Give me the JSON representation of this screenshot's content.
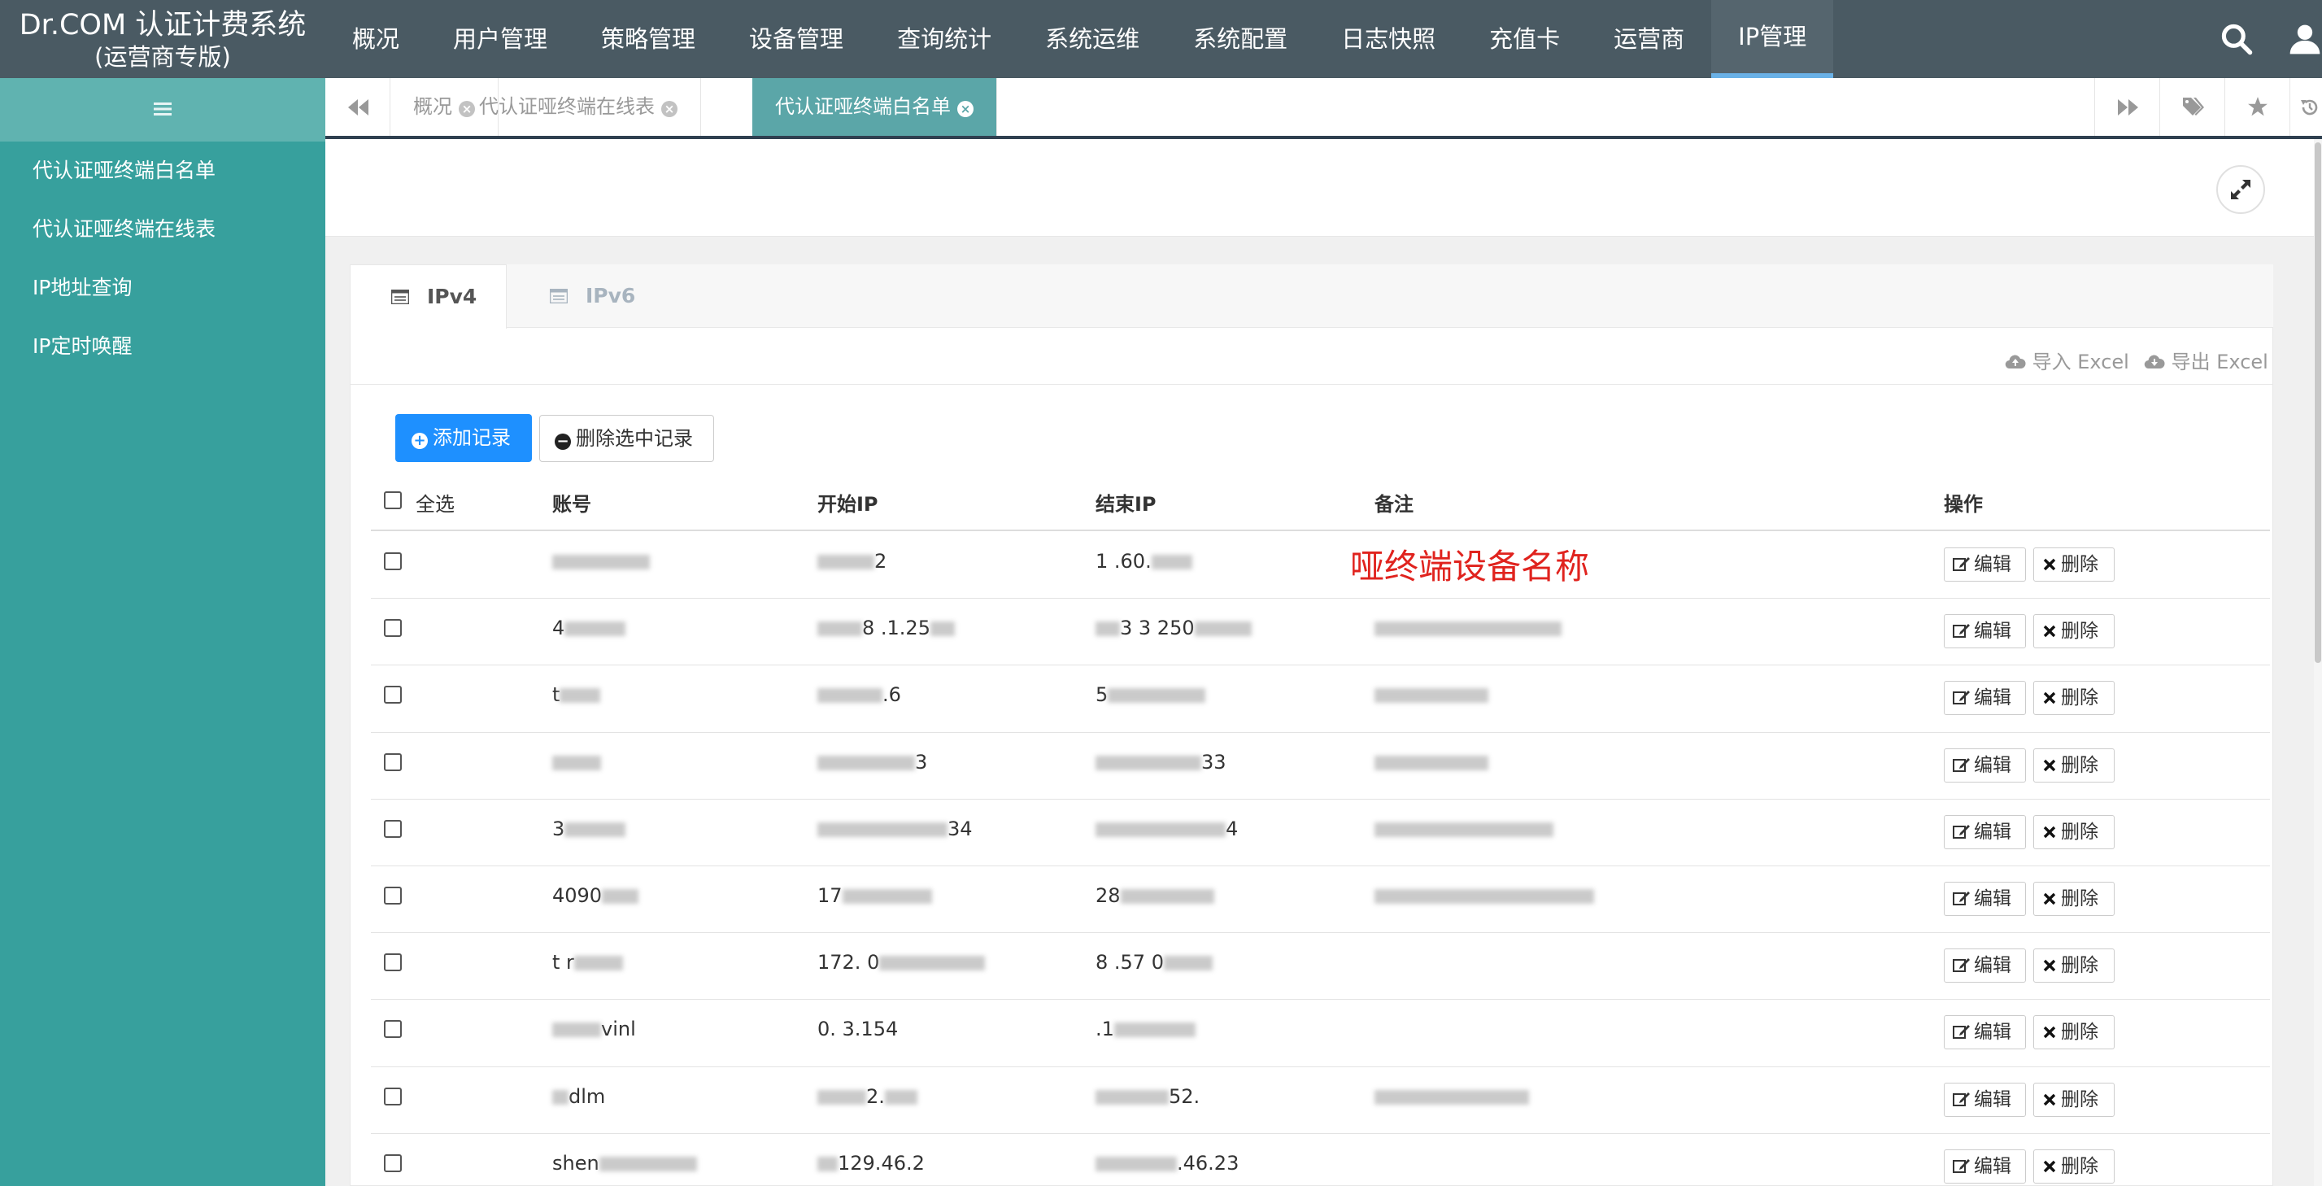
{
  "brand": {
    "line1": "Dr.COM 认证计费系统",
    "line2": "(运营商专版)"
  },
  "nav": [
    {
      "label": "概况"
    },
    {
      "label": "用户管理"
    },
    {
      "label": "策略管理"
    },
    {
      "label": "设备管理"
    },
    {
      "label": "查询统计"
    },
    {
      "label": "系统运维"
    },
    {
      "label": "系统配置"
    },
    {
      "label": "日志快照"
    },
    {
      "label": "充值卡"
    },
    {
      "label": "运营商"
    },
    {
      "label": "IP管理"
    }
  ],
  "nav_active": "IP管理",
  "sidebar": {
    "items": [
      {
        "label": "代认证哑终端白名单"
      },
      {
        "label": "代认证哑终端在线表"
      },
      {
        "label": "IP地址查询"
      },
      {
        "label": "IP定时唤醒"
      }
    ]
  },
  "page_tabs": [
    {
      "label": "概况",
      "active": false
    },
    {
      "label": "代认证哑终端在线表",
      "active": false
    },
    {
      "label": "代认证哑终端白名单",
      "active": true
    }
  ],
  "ip_tabs": [
    {
      "label": "IPv4",
      "active": true
    },
    {
      "label": "IPv6",
      "active": false
    }
  ],
  "excel": {
    "import_label": "导入 Excel",
    "export_label": "导出 Excel"
  },
  "toolbar": {
    "add_label": "添加记录",
    "delete_selected_label": "删除选中记录"
  },
  "table": {
    "select_all_label": "全选",
    "columns": [
      "账号",
      "开始IP",
      "结束IP",
      "备注",
      "操作"
    ],
    "edit_label": "编辑",
    "delete_label": "删除",
    "rows": [
      {
        "account": "",
        "start_ip": "2",
        "end_ip": "1 .60.",
        "remark": ""
      },
      {
        "account": "4",
        "start_ip": "8 .1.25",
        "end_ip": "3 3 250",
        "remark": ""
      },
      {
        "account": "t",
        "start_ip": ".6",
        "end_ip": "5",
        "remark": ""
      },
      {
        "account": "",
        "start_ip": "3",
        "end_ip": "33",
        "remark": ""
      },
      {
        "account": "3",
        "start_ip": "34",
        "end_ip": "4",
        "remark": ""
      },
      {
        "account": "4090",
        "start_ip": "17",
        "end_ip": "28",
        "remark": ""
      },
      {
        "account": "t r",
        "start_ip": "172. 0",
        "end_ip": "8 .57 0",
        "remark": ""
      },
      {
        "account": "vinl",
        "start_ip": "0. 3.154",
        "end_ip": ".1",
        "remark": ""
      },
      {
        "account": "dlm",
        "start_ip": "2.",
        "end_ip": "52.",
        "remark": ""
      },
      {
        "account": "shen",
        "start_ip": "129.46.2",
        "end_ip": ".46.23",
        "remark": ""
      }
    ]
  },
  "annotation": {
    "text": "哑终端设备名称"
  },
  "colors": {
    "topbar": "#4a5a63",
    "sidebar": "#37a09d",
    "active_tab": "#5ba6a8",
    "primary_button": "#1e90ff",
    "annotation": "#e0231e"
  }
}
